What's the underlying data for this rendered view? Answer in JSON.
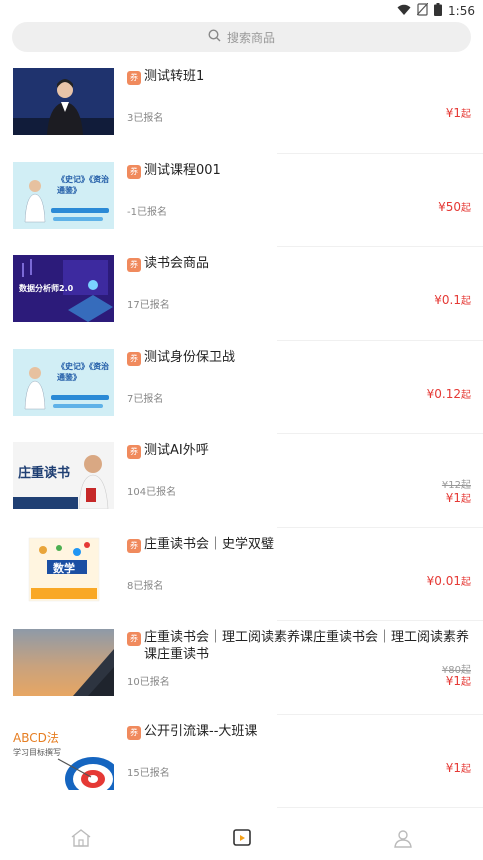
{
  "status": {
    "time": "1:56"
  },
  "search": {
    "placeholder": "搜索商品"
  },
  "badge_text": "券",
  "items": [
    {
      "title": "测试转班1",
      "enroll": "3已报名",
      "price": "¥1",
      "unit": "起",
      "old_price": ""
    },
    {
      "title": "测试课程001",
      "enroll": "-1已报名",
      "price": "¥50",
      "unit": "起",
      "old_price": ""
    },
    {
      "title": "读书会商品",
      "enroll": "17已报名",
      "price": "¥0.1",
      "unit": "起",
      "old_price": ""
    },
    {
      "title": "测试身份保卫战",
      "enroll": "7已报名",
      "price": "¥0.12",
      "unit": "起",
      "old_price": ""
    },
    {
      "title": "测试AI外呼",
      "enroll": "104已报名",
      "price": "¥1",
      "unit": "起",
      "old_price": "¥12起"
    },
    {
      "title": "庄重读书会｜史学双璧",
      "enroll": "8已报名",
      "price": "¥0.01",
      "unit": "起",
      "old_price": ""
    },
    {
      "title": "庄重读书会｜理工阅读素养课庄重读书会｜理工阅读素养课庄重读书",
      "enroll": "10已报名",
      "price": "¥1",
      "unit": "起",
      "old_price": "¥80起"
    },
    {
      "title": "公开引流课--大班课",
      "enroll": "15已报名",
      "price": "¥1",
      "unit": "起",
      "old_price": ""
    }
  ],
  "thumb_text": {
    "t2": "《史记》《资治通鉴》",
    "t3": "数据分析师2.0",
    "t5": "庄重读书",
    "t6": "数学",
    "t8a": "ABCD法",
    "t8b": "学习目标撰写"
  },
  "colors": {
    "accent": "#f08a5d",
    "price": "#e53935"
  },
  "tabs": [
    "home-icon",
    "course-icon",
    "profile-icon"
  ]
}
